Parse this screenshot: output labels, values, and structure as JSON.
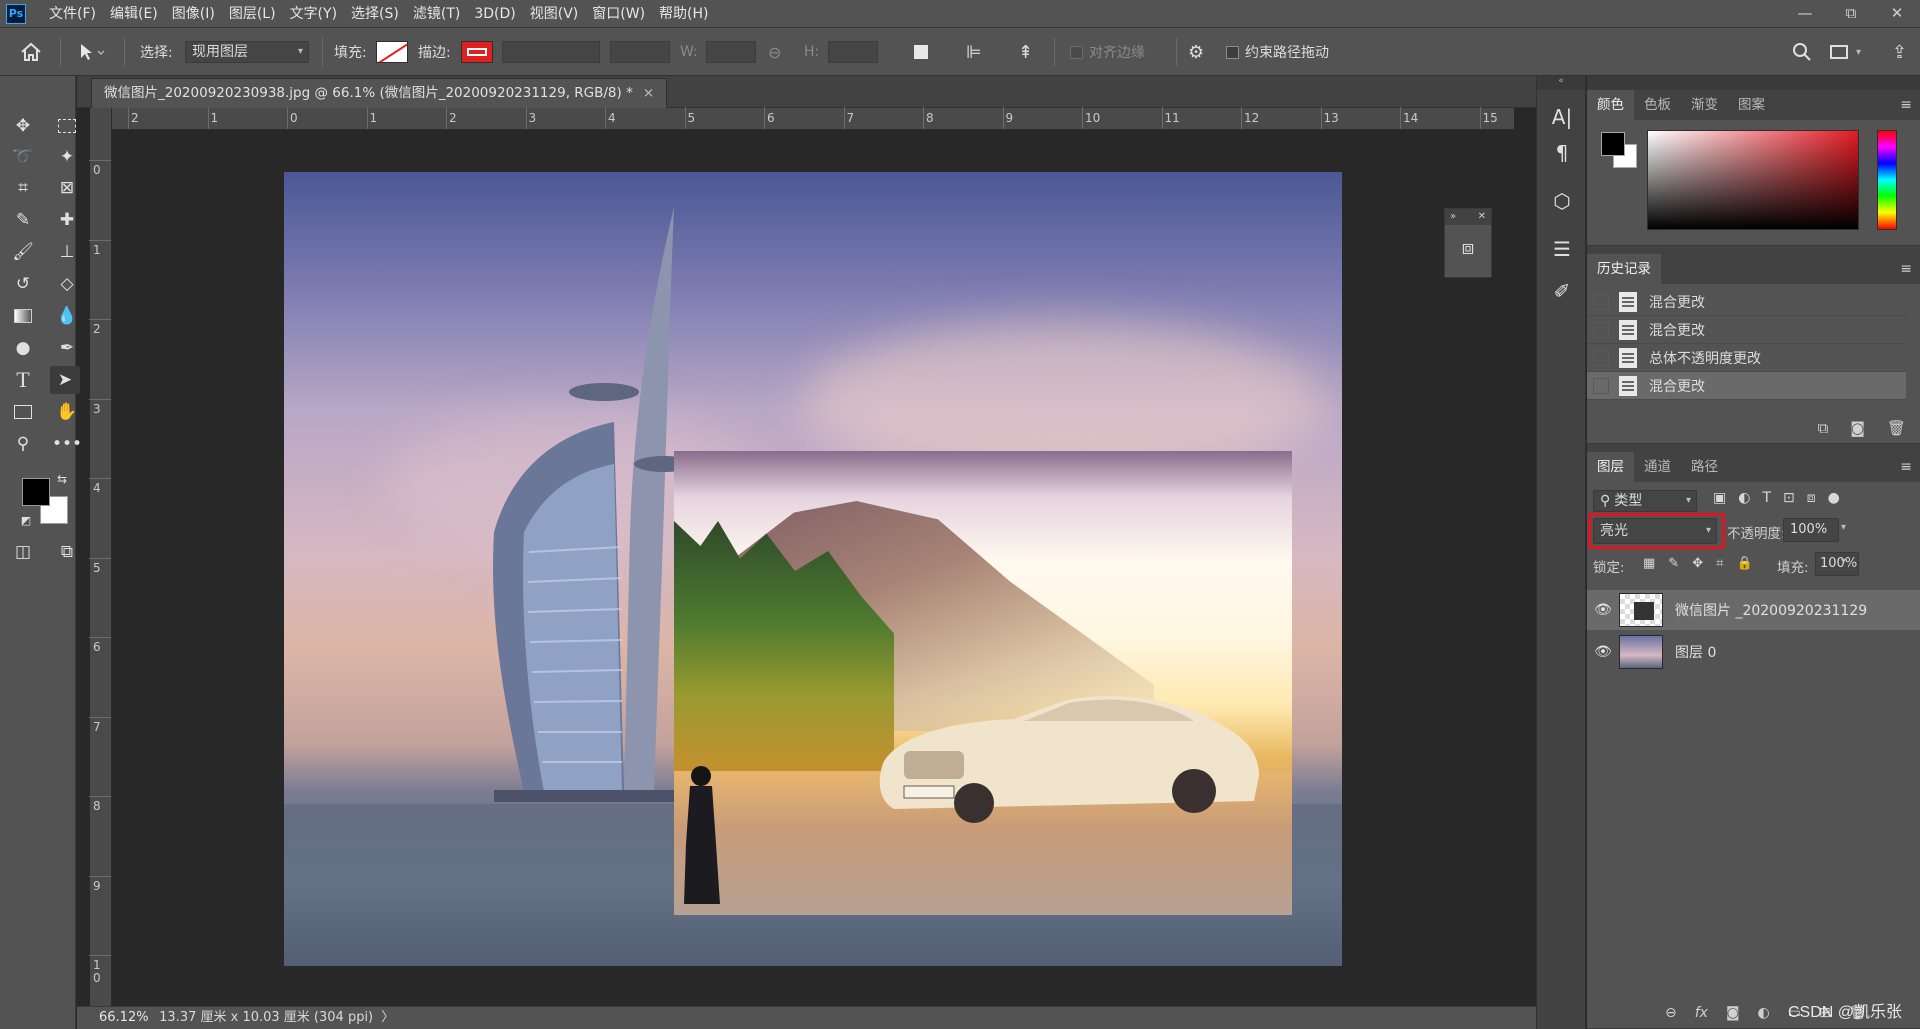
{
  "app": {
    "logo": "Ps"
  },
  "menu": [
    "文件(F)",
    "编辑(E)",
    "图像(I)",
    "图层(L)",
    "文字(Y)",
    "选择(S)",
    "滤镜(T)",
    "3D(D)",
    "视图(V)",
    "窗口(W)",
    "帮助(H)"
  ],
  "window_controls": {
    "minimize": "—",
    "restore": "⧉",
    "close": "✕"
  },
  "options": {
    "select_label": "选择:",
    "select_value": "现用图层",
    "fill_label": "填充:",
    "stroke_label": "描边:",
    "w_label": "W:",
    "h_label": "H:",
    "align_edges": "对齐边缘",
    "constrain_path": "约束路径拖动"
  },
  "document": {
    "tab_title": "微信图片_20200920230938.jpg @ 66.1% (微信图片_20200920231129, RGB/8) *",
    "close": "×"
  },
  "ruler": {
    "top": [
      "2",
      "1",
      "0",
      "1",
      "2",
      "3",
      "4",
      "5",
      "6",
      "7",
      "8",
      "9",
      "10",
      "11",
      "12",
      "13",
      "14",
      "15"
    ],
    "left": [
      "0",
      "1",
      "2",
      "3",
      "4",
      "5",
      "6",
      "7",
      "8",
      "9",
      "1\n0"
    ]
  },
  "statusbar": {
    "zoom": "66.12%",
    "info": "13.37 厘米 x 10.03 厘米 (304 ppi)",
    "arrow": "〉"
  },
  "color_panel": {
    "tabs": [
      "颜色",
      "色板",
      "渐变",
      "图案"
    ],
    "active_tab": "颜色"
  },
  "history_panel": {
    "title": "历史记录",
    "items": [
      "混合更改",
      "混合更改",
      "总体不透明度更改",
      "混合更改"
    ],
    "selected_index": 3
  },
  "layers_panel": {
    "tabs": [
      "图层",
      "通道",
      "路径"
    ],
    "filter_label": "类型",
    "blend_mode": "亮光",
    "opacity_label": "不透明度:",
    "opacity_value": "100%",
    "lock_label": "锁定:",
    "fill_label": "填充:",
    "fill_value": "100%",
    "layers": [
      {
        "name": "微信图片 _20200920231129",
        "selected": true
      },
      {
        "name": "图层 0",
        "selected": false
      }
    ],
    "footer_fx": "fx"
  },
  "watermark": "CSDN @凯乐张",
  "colors": {
    "highlight": "#e0141e",
    "foreground": "#000000",
    "background": "#ffffff"
  }
}
